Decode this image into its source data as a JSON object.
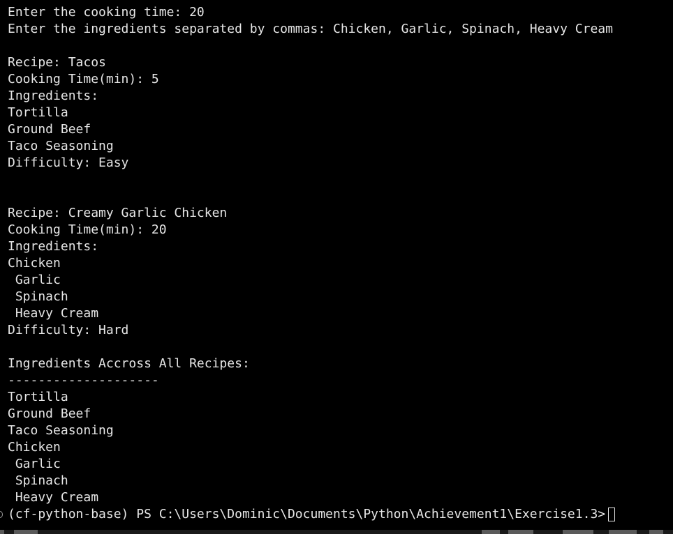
{
  "terminal": {
    "lines": [
      "Enter the cooking time: 20",
      "Enter the ingredients separated by commas: Chicken, Garlic, Spinach, Heavy Cream",
      "",
      "Recipe: Tacos",
      "Cooking Time(min): 5",
      "Ingredients:",
      "Tortilla",
      "Ground Beef",
      "Taco Seasoning",
      "Difficulty: Easy",
      "",
      "",
      "Recipe: Creamy Garlic Chicken",
      "Cooking Time(min): 20",
      "Ingredients:",
      "Chicken",
      " Garlic",
      " Spinach",
      " Heavy Cream",
      "Difficulty: Hard",
      "",
      "Ingredients Accross All Recipes:",
      "--------------------",
      "Tortilla",
      "Ground Beef",
      "Taco Seasoning",
      "Chicken",
      " Garlic",
      " Spinach",
      " Heavy Cream"
    ],
    "prompt": "(cf-python-base) PS C:\\Users\\Dominic\\Documents\\Python\\Achievement1\\Exercise1.3>"
  }
}
